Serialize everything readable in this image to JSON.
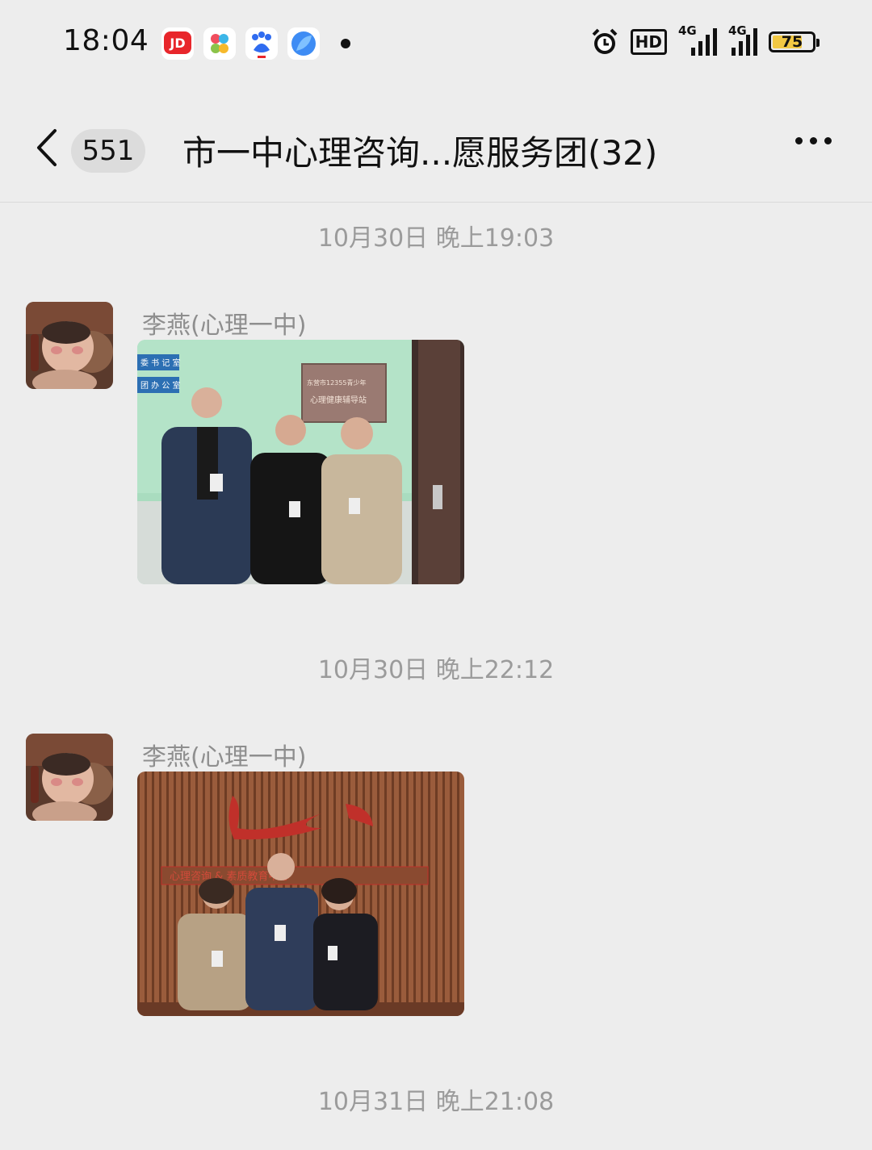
{
  "status_bar": {
    "time": "18:04",
    "app_icons": [
      "jd-1111-icon",
      "flower-app-icon",
      "baidu-icon",
      "blue-leaf-app-icon"
    ],
    "hd_label": "HD",
    "signal_label_1": "4G",
    "signal_label_2": "4G",
    "battery": "75",
    "battery_level": 0.75
  },
  "nav": {
    "unread_count": "551",
    "title": "市一中心理咨询...愿服务团(32)"
  },
  "messages": [
    {
      "timestamp": "10月30日 晚上19:03",
      "sender": "李燕(心理一中)",
      "photo_signs": [
        "委 书 记 室",
        "团 办 公 室",
        "东营市12355青少年",
        "心理健康辅导站"
      ]
    },
    {
      "timestamp": "10月30日 晚上22:12",
      "sender": "李燕(心理一中)",
      "photo_signs": [
        "心理咨询 & 素质教育中心"
      ]
    },
    {
      "timestamp": "10月31日 晚上21:08"
    }
  ],
  "colors": {
    "background": "#ededed",
    "timestamp_text": "#9b9b9b",
    "sender_text": "#8e8e8e",
    "battery_fill": "#f2c843"
  }
}
